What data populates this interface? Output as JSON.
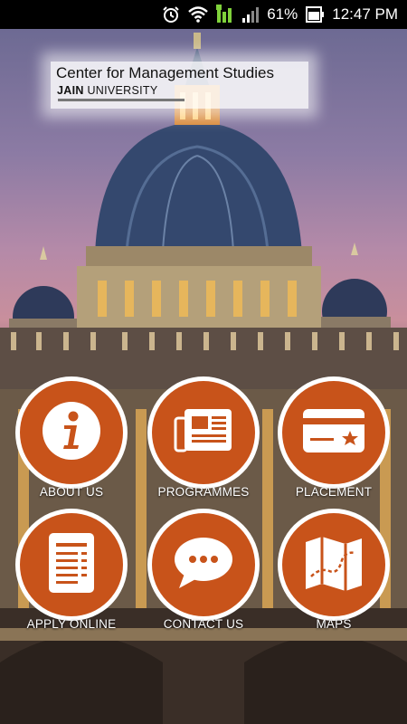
{
  "status_bar": {
    "battery_percent": "61%",
    "time": "12:47 PM",
    "icons": [
      "alarm-icon",
      "wifi-icon",
      "data-signal-icon",
      "cell-signal-icon",
      "battery-icon"
    ]
  },
  "logo": {
    "title": "Center for Management Studies",
    "brand_bold": "JAIN",
    "brand_rest": " UNIVERSITY"
  },
  "menu": [
    {
      "label": "ABOUT US",
      "icon": "info-icon"
    },
    {
      "label": "PROGRAMMES",
      "icon": "newspaper-icon"
    },
    {
      "label": "PLACEMENT",
      "icon": "card-star-icon"
    },
    {
      "label": "APPLY ONLINE",
      "icon": "form-document-icon"
    },
    {
      "label": "CONTACT US",
      "icon": "chat-bubble-icon"
    },
    {
      "label": "MAPS",
      "icon": "map-icon"
    }
  ],
  "colors": {
    "button": "#c8531a",
    "button_border": "#ffffff"
  }
}
